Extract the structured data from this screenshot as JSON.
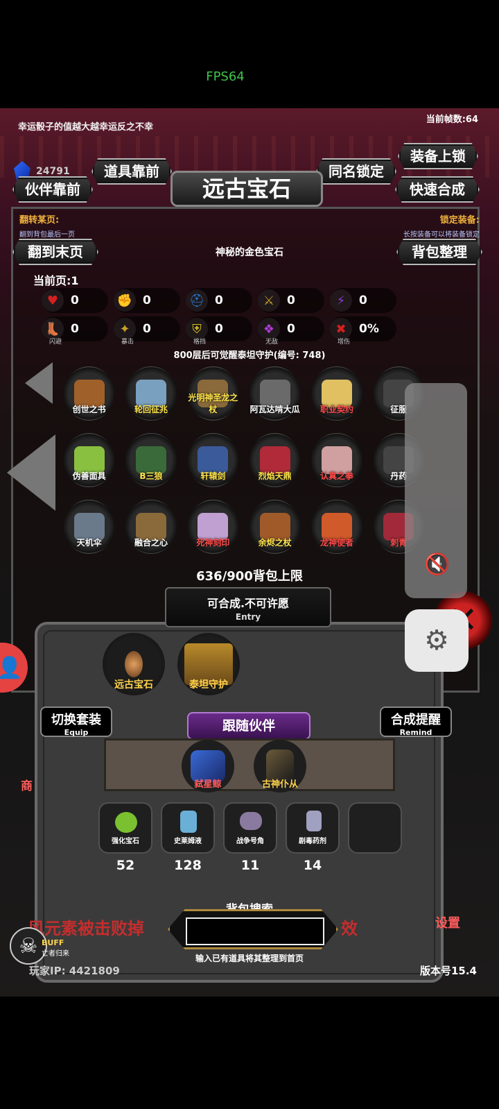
{
  "status": {
    "fps_overlay": "FPS64"
  },
  "header": {
    "tip": "幸运骰子的值越大越幸运反之不幸",
    "fps_label": "当前帧数:64",
    "gem_count": "24791",
    "title": "远古宝石"
  },
  "buttons": {
    "equip_lock": "装备上锁",
    "item_front": "道具靠前",
    "same_name_lock": "同名锁定",
    "partner_front": "伙伴靠前",
    "quick_merge": "快速合成",
    "last_page": "翻到末页",
    "bag_sort": "背包整理"
  },
  "notes": {
    "flip_title": "翻转某页:",
    "flip_sub": "翻到背包最后一页",
    "lock_title": "锁定装备:",
    "lock_sub": "长按装备可以将装备锁定"
  },
  "mystery_text": "神秘的金色宝石",
  "current_page": "当前页:1",
  "stats_row1": [
    {
      "icon": "heart-icon",
      "symbol": "♥",
      "color": "#d62020",
      "value": "0"
    },
    {
      "icon": "muscle-icon",
      "symbol": "✊",
      "color": "#d6a520",
      "value": "0"
    },
    {
      "icon": "helmet-icon",
      "symbol": "⛑",
      "color": "#2a7ad6",
      "value": "0"
    },
    {
      "icon": "sword-icon",
      "symbol": "⚔",
      "color": "#c9a02a",
      "value": "0"
    },
    {
      "icon": "lightning-icon",
      "symbol": "⚡",
      "color": "#8a3ad6",
      "value": "0"
    }
  ],
  "stats_row2": [
    {
      "icon": "boot-icon",
      "symbol": "👢",
      "color": "#2a7ad6",
      "caption": "闪避",
      "value": "0"
    },
    {
      "icon": "crit-icon",
      "symbol": "✦",
      "color": "#c9a02a",
      "caption": "暴击",
      "value": "0"
    },
    {
      "icon": "shield-icon",
      "symbol": "⛨",
      "color": "#d6c020",
      "caption": "格挡",
      "value": "0"
    },
    {
      "icon": "wings-icon",
      "symbol": "❖",
      "color": "#b03ad6",
      "caption": "无敌",
      "value": "0"
    },
    {
      "icon": "damage-icon",
      "symbol": "✖",
      "color": "#d62020",
      "caption": "增伤",
      "value": "0%"
    }
  ],
  "awaken_text": "800层后可觉醒泰坦守护(编号: 748)",
  "items": [
    [
      {
        "name": "创世之书",
        "color": "#a0602a",
        "style": "white"
      },
      {
        "name": "轮回征兆",
        "color": "#7aa0c0",
        "style": "yellow"
      },
      {
        "name": "光明神圣龙之杖",
        "color": "#8a6a3a",
        "style": "yellow"
      },
      {
        "name": "阿瓦达啃大瓜",
        "color": "#6a6a6a",
        "style": "white"
      },
      {
        "name": "职业契约",
        "color": "#e0c060",
        "style": "red"
      },
      {
        "name": "征服",
        "color": "#444",
        "style": "white"
      }
    ],
    [
      {
        "name": "伪善面具",
        "color": "#8ac040",
        "style": "white"
      },
      {
        "name": "B三狼",
        "color": "#3a6a3a",
        "style": "yellow"
      },
      {
        "name": "轩辕剑",
        "color": "#3a5a9a",
        "style": "yellow"
      },
      {
        "name": "烈焰天鼎",
        "color": "#b02a3a",
        "style": "yellow"
      },
      {
        "name": "认真之拳",
        "color": "#d0a0a0",
        "style": "red"
      },
      {
        "name": "丹药",
        "color": "#444",
        "style": "white"
      }
    ],
    [
      {
        "name": "天机伞",
        "color": "#6a7a8a",
        "style": "white"
      },
      {
        "name": "融合之心",
        "color": "#8a6a3a",
        "style": "white"
      },
      {
        "name": "死神刻印",
        "color": "#c0a0d0",
        "style": "red"
      },
      {
        "name": "余烬之杖",
        "color": "#a05a2a",
        "style": "yellow"
      },
      {
        "name": "龙神使者",
        "color": "#d05a2a",
        "style": "red"
      },
      {
        "name": "刺青",
        "color": "#a02a3a",
        "style": "red"
      }
    ]
  ],
  "capacity": "636/900背包上限",
  "entry": {
    "main": "可合成.不可许愿",
    "sub": "Entry"
  },
  "selected": [
    {
      "name": "远古宝石"
    },
    {
      "name": "泰坦守护"
    }
  ],
  "side_buttons": {
    "switch_main": "切换套装",
    "switch_sub": "Equip",
    "remind_main": "合成提醒",
    "remind_sub": "Remind"
  },
  "follow": {
    "title": "跟随伙伴",
    "partners": [
      {
        "name": "弑星鲸",
        "color": "#ff5c5c"
      },
      {
        "name": "古神仆从",
        "color": "#ffd34a"
      }
    ]
  },
  "consumables": [
    {
      "name": "强化宝石",
      "count": "52"
    },
    {
      "name": "史莱姆液",
      "count": "128"
    },
    {
      "name": "战争号角",
      "count": "11"
    },
    {
      "name": "剧毒药剂",
      "count": "14"
    }
  ],
  "search": {
    "title": "背包搜索",
    "hint": "输入已有道具将其整理到首页",
    "value": ""
  },
  "scroll_left": "风元素被击败掉",
  "scroll_right": "效",
  "buff": {
    "label": "BUFF",
    "sub": "亡者归来"
  },
  "player_ip": "玩家IP: 4421809",
  "version": "版本号15.4",
  "side_labels": {
    "shop": "商",
    "settings": "设置"
  }
}
